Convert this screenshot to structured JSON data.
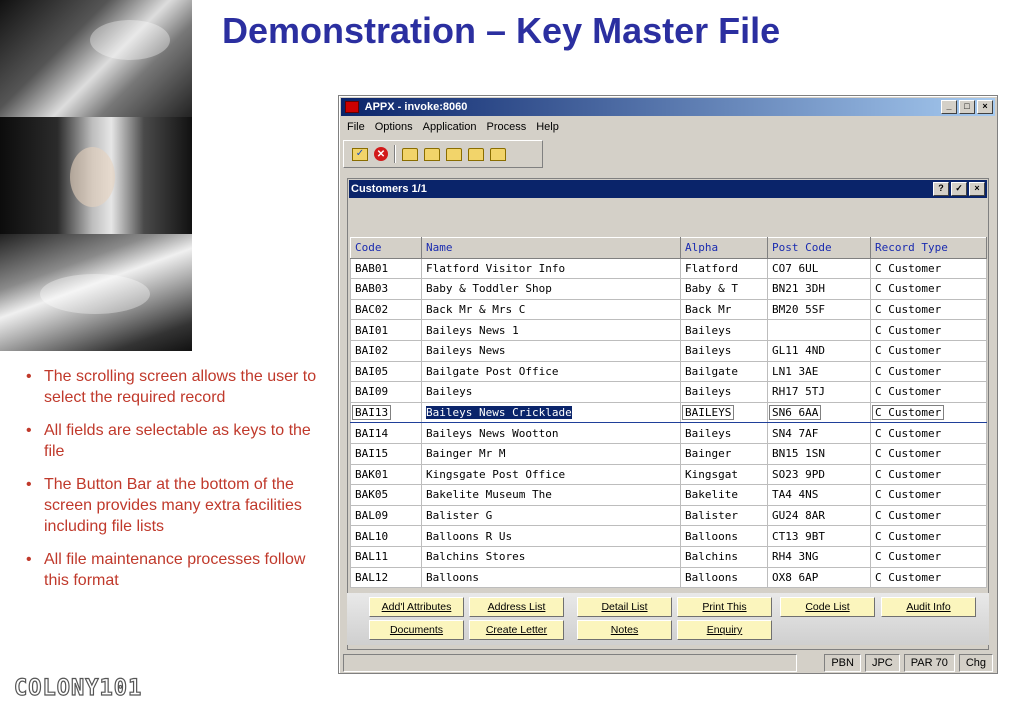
{
  "slide": {
    "title": "Demonstration – Key Master File",
    "bullets": [
      "The scrolling screen allows the user to select the required record",
      "All fields are selectable as keys to the file",
      "The Button Bar at the bottom of the screen provides many extra facilities including file lists",
      "All file maintenance processes follow this format"
    ],
    "logo": "COLONY101"
  },
  "window": {
    "title": "APPX - invoke:8060",
    "controls": [
      "_",
      "□",
      "×"
    ],
    "menu": [
      "File",
      "Options",
      "Application",
      "Process",
      "Help"
    ]
  },
  "toolbar": {
    "icons": [
      "check-folder-icon",
      "cancel-icon",
      "folder-new-icon",
      "folder-up-icon",
      "folder-search-icon",
      "folder-delete-icon",
      "folder-check-icon"
    ]
  },
  "panel": {
    "title": "Customers 1/1",
    "controls": [
      "?",
      "✓",
      "×"
    ],
    "columns": [
      "Code",
      "Name",
      "Alpha",
      "Post Code",
      "Record Type"
    ],
    "rows": [
      [
        "BAB01",
        "Flatford Visitor Info",
        "Flatford",
        "CO7 6UL",
        "C Customer"
      ],
      [
        "BAB03",
        "Baby & Toddler Shop",
        "Baby & T",
        "BN21 3DH",
        "C Customer"
      ],
      [
        "BAC02",
        "Back Mr & Mrs C",
        "Back Mr",
        "BM20 5SF",
        "C Customer"
      ],
      [
        "BAI01",
        "Baileys News 1",
        "Baileys",
        "",
        "C Customer"
      ],
      [
        "BAI02",
        "Baileys News",
        "Baileys",
        "GL11 4ND",
        "C Customer"
      ],
      [
        "BAI05",
        "Bailgate Post Office",
        "Bailgate",
        "LN1 3AE",
        "C Customer"
      ],
      [
        "BAI09",
        "Baileys",
        "Baileys",
        "RH17 5TJ",
        "C Customer"
      ],
      [
        "BAI13",
        "Baileys News Cricklade",
        "BAILEYS",
        "SN6 6AA",
        "C Customer"
      ],
      [
        "BAI14",
        "Baileys News Wootton",
        "Baileys",
        "SN4 7AF",
        "C Customer"
      ],
      [
        "BAI15",
        "Bainger Mr M",
        "Bainger",
        "BN15 1SN",
        "C Customer"
      ],
      [
        "BAK01",
        "Kingsgate Post Office",
        "Kingsgat",
        "SO23 9PD",
        "C Customer"
      ],
      [
        "BAK05",
        "Bakelite Museum The",
        "Bakelite",
        "TA4 4NS",
        "C Customer"
      ],
      [
        "BAL09",
        "Balister G",
        "Balister",
        "GU24 8AR",
        "C Customer"
      ],
      [
        "BAL10",
        "Balloons R Us",
        "Balloons",
        "CT13 9BT",
        "C Customer"
      ],
      [
        "BAL11",
        "Balchins Stores",
        "Balchins",
        "RH4 3NG",
        "C Customer"
      ],
      [
        "BAL12",
        "Balloons",
        "Balloons",
        "OX8 6AP",
        "C Customer"
      ]
    ],
    "selected_row": 7
  },
  "buttons": {
    "row1": [
      "Add'l Attributes",
      "Address List",
      "Detail List",
      "Print This",
      "Code List",
      "Audit Info"
    ],
    "row2": [
      "Documents",
      "Create Letter",
      "Notes",
      "Enquiry"
    ]
  },
  "status": [
    "PBN",
    "JPC",
    "PAR 70",
    "Chg"
  ]
}
